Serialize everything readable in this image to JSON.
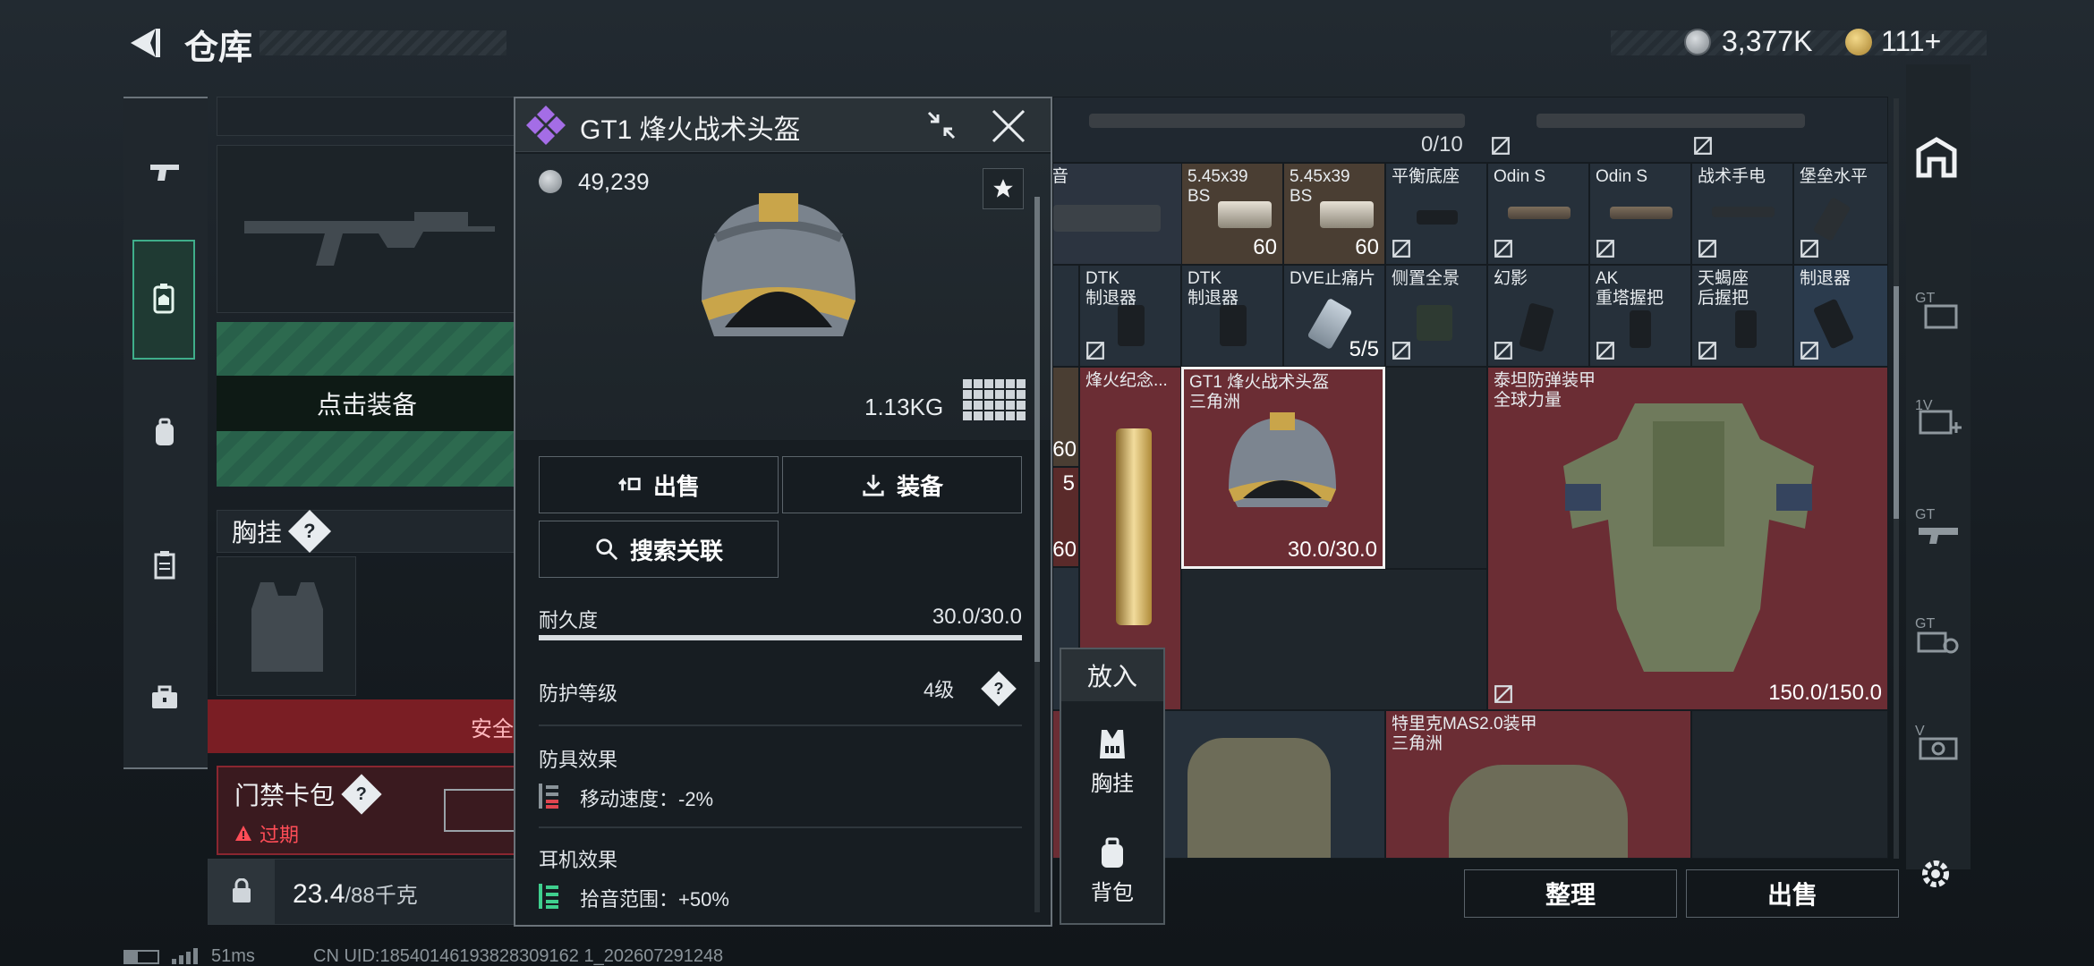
{
  "header": {
    "title": "仓库",
    "currency": "3,377K",
    "points": "111+"
  },
  "left": {
    "equip_label": "点击装备",
    "chest_rig_label": "胸挂",
    "help": "?",
    "safe_box_text": "安全",
    "keycard_label": "门禁卡包",
    "expired_label": "过期",
    "weight_value": "23.4",
    "weight_max": "/88千克"
  },
  "status": {
    "ping": "51ms",
    "uid": "CN UID:18540146193828309162 1_202607291248"
  },
  "popup": {
    "title": "GT1 烽火战术头盔",
    "price": "49,239",
    "weight": "1.13KG",
    "sell": "出售",
    "equip": "装备",
    "search": "搜索关联",
    "durability_label": "耐久度",
    "durability_value": "30.0/30.0",
    "durability_fraction": 1.0,
    "protection_label": "防护等级",
    "protection_value": "4级",
    "armor_effect_label": "防具效果",
    "move_speed": "移动速度：-2%",
    "headset_label": "耳机效果",
    "hearing": "拾音范围：+50%"
  },
  "grid": {
    "row0": {
      "count": "0/10"
    },
    "row1": [
      {
        "name": "音"
      },
      {
        "name": "5.45x39\nBS",
        "count": "60"
      },
      {
        "name": "5.45x39\nBS",
        "count": "60"
      },
      {
        "name": "平衡底座"
      },
      {
        "name": "Odin S"
      },
      {
        "name": "Odin S"
      },
      {
        "name": "战术手电"
      },
      {
        "name": "堡垒水平"
      }
    ],
    "row2": [
      {
        "name": "DTK\n制退器"
      },
      {
        "name": "DTK\n制退器"
      },
      {
        "name": "DVE止痛片",
        "count": "5/5"
      },
      {
        "name": "侧置全景"
      },
      {
        "name": "幻影"
      },
      {
        "name": "AK\n重塔握把"
      },
      {
        "name": "天蝎座\n后握把"
      },
      {
        "name": "制退器"
      }
    ],
    "partial_left": {
      "a": "60",
      "b": "5",
      "c": "60"
    },
    "souvenir": "烽火纪念...",
    "helmet_cell": {
      "name": "GT1 烽火战术头盔\n三角洲",
      "count": "30.0/30.0"
    },
    "armor_cell": {
      "name": "泰坦防弹装甲\n全球力量",
      "count": "150.0/150.0"
    },
    "bottom_cell": {
      "name": "特里克MAS2.0装甲\n三角洲"
    }
  },
  "put_in": {
    "title": "放入",
    "chest": "胸挂",
    "bag": "背包"
  },
  "bottom_buttons": {
    "sort": "整理",
    "sell": "出售"
  }
}
